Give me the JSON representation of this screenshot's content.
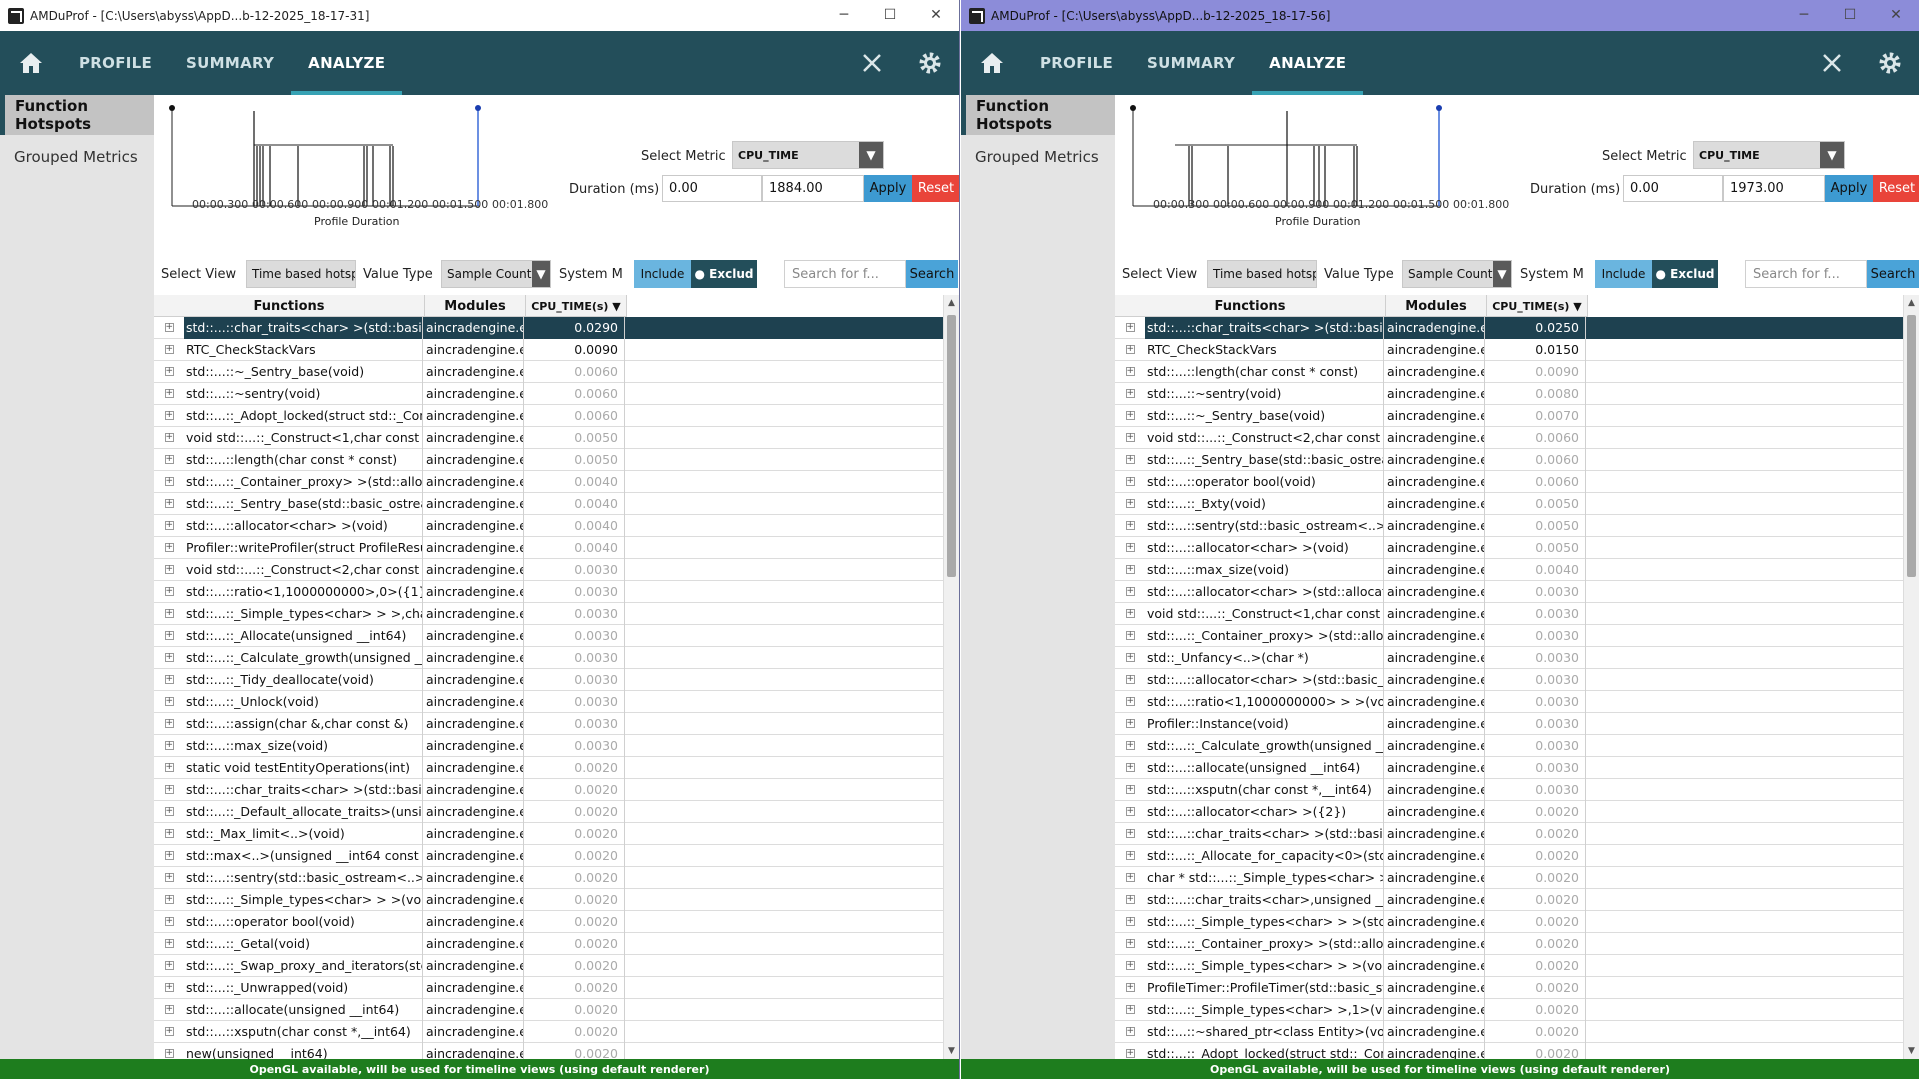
{
  "windows": [
    {
      "title": "AMDuProf - [C:\\Users\\abyss\\AppD...b-12-2025_18-17-31]",
      "window_buttons": [
        "─",
        "☐",
        "✕"
      ],
      "nav": {
        "tabs": [
          "PROFILE",
          "SUMMARY",
          "ANALYZE"
        ],
        "active": "ANALYZE"
      },
      "sidebar": [
        "Function Hotspots",
        "Grouped Metrics"
      ],
      "timeline": {
        "ticks": [
          "00:00.300",
          "00:00.600",
          "00:00.900",
          "00:01.200",
          "00:01.500",
          "00:01.800"
        ],
        "caption": "Profile Duration"
      },
      "controls": {
        "select_metric_label": "Select Metric",
        "metric_value": "CPU_TIME",
        "duration_label": "Duration (ms)",
        "duration_start": "0.00",
        "duration_end": "1884.00",
        "apply": "Apply",
        "reset": "Reset",
        "select_view_label": "Select View",
        "select_view_value": "Time based hotspots",
        "value_type_label": "Value Type",
        "value_type_value": "Sample Count",
        "system_label": "System M",
        "include": "Include",
        "exclude": "● Exclud",
        "search_placeholder": "Search for f...",
        "search_button": "Search"
      },
      "table": {
        "headers": [
          "Functions",
          "Modules",
          "CPU_TIME(s) ▼"
        ],
        "rows": [
          {
            "fn": "std::...::char_traits<char> >(std::basic_ostream",
            "mod": "aincradengine.exe",
            "cpu": "0.0290"
          },
          {
            "fn": "RTC_CheckStackVars",
            "mod": "aincradengine.exe",
            "cpu": "0.0090"
          },
          {
            "fn": "std::...::~_Sentry_base(void)",
            "mod": "aincradengine.exe",
            "cpu": "0.0060"
          },
          {
            "fn": "std::...::~sentry(void)",
            "mod": "aincradengine.exe",
            "cpu": "0.0060"
          },
          {
            "fn": "std::...::_Adopt_locked(struct std::_Container",
            "mod": "aincradengine.exe",
            "cpu": "0.0060"
          },
          {
            "fn": "void std::...::_Construct<1,char const *>",
            "mod": "aincradengine.exe",
            "cpu": "0.0050"
          },
          {
            "fn": "std::...::length(char const * const)",
            "mod": "aincradengine.exe",
            "cpu": "0.0050"
          },
          {
            "fn": "std::...::_Container_proxy> >(std::allocator",
            "mod": "aincradengine.exe",
            "cpu": "0.0040"
          },
          {
            "fn": "std::...::_Sentry_base(std::basic_ostream",
            "mod": "aincradengine.exe",
            "cpu": "0.0040"
          },
          {
            "fn": "std::...::allocator<char> >(void)",
            "mod": "aincradengine.exe",
            "cpu": "0.0040"
          },
          {
            "fn": "Profiler::writeProfiler(struct ProfileResult",
            "mod": "aincradengine.exe",
            "cpu": "0.0040"
          },
          {
            "fn": "void std::...::_Construct<2,char const *>",
            "mod": "aincradengine.exe",
            "cpu": "0.0030"
          },
          {
            "fn": "std::...::ratio<1,1000000000>,0>({1})",
            "mod": "aincradengine.exe",
            "cpu": "0.0030"
          },
          {
            "fn": "std::...::_Simple_types<char> > >,char>",
            "mod": "aincradengine.exe",
            "cpu": "0.0030"
          },
          {
            "fn": "std::...::_Allocate(unsigned __int64)",
            "mod": "aincradengine.exe",
            "cpu": "0.0030"
          },
          {
            "fn": "std::...::_Calculate_growth(unsigned __int64",
            "mod": "aincradengine.exe",
            "cpu": "0.0030"
          },
          {
            "fn": "std::...::_Tidy_deallocate(void)",
            "mod": "aincradengine.exe",
            "cpu": "0.0030"
          },
          {
            "fn": "std::...::_Unlock(void)",
            "mod": "aincradengine.exe",
            "cpu": "0.0030"
          },
          {
            "fn": "std::...::assign(char &,char const &)",
            "mod": "aincradengine.exe",
            "cpu": "0.0030"
          },
          {
            "fn": "std::...::max_size(void)",
            "mod": "aincradengine.exe",
            "cpu": "0.0030"
          },
          {
            "fn": "static void testEntityOperations(int)",
            "mod": "aincradengine.exe",
            "cpu": "0.0020"
          },
          {
            "fn": "std::...::char_traits<char> >(std::basic_ostream",
            "mod": "aincradengine.exe",
            "cpu": "0.0020"
          },
          {
            "fn": "std::...::_Default_allocate_traits>(unsigned",
            "mod": "aincradengine.exe",
            "cpu": "0.0020"
          },
          {
            "fn": "std::_Max_limit<..>(void)",
            "mod": "aincradengine.exe",
            "cpu": "0.0020"
          },
          {
            "fn": "std::max<..>(unsigned __int64 const &,unsigned",
            "mod": "aincradengine.exe",
            "cpu": "0.0020"
          },
          {
            "fn": "std::...::sentry(std::basic_ostream<..> &",
            "mod": "aincradengine.exe",
            "cpu": "0.0020"
          },
          {
            "fn": "std::...::_Simple_types<char> > >(void)",
            "mod": "aincradengine.exe",
            "cpu": "0.0020"
          },
          {
            "fn": "std::...::operator bool(void)",
            "mod": "aincradengine.exe",
            "cpu": "0.0020"
          },
          {
            "fn": "std::...::_Getal(void)",
            "mod": "aincradengine.exe",
            "cpu": "0.0020"
          },
          {
            "fn": "std::...::_Swap_proxy_and_iterators(std::",
            "mod": "aincradengine.exe",
            "cpu": "0.0020"
          },
          {
            "fn": "std::...::_Unwrapped(void)",
            "mod": "aincradengine.exe",
            "cpu": "0.0020"
          },
          {
            "fn": "std::...::allocate(unsigned __int64)",
            "mod": "aincradengine.exe",
            "cpu": "0.0020"
          },
          {
            "fn": "std::...::xsputn(char const *,__int64)",
            "mod": "aincradengine.exe",
            "cpu": "0.0020"
          },
          {
            "fn": "new(unsigned __int64)",
            "mod": "aincradengine.exe",
            "cpu": "0.0020"
          }
        ]
      },
      "status": "OpenGL available, will be used for timeline views (using default renderer)"
    },
    {
      "title": "AMDuProf - [C:\\Users\\abyss\\AppD...b-12-2025_18-17-56]",
      "window_buttons": [
        "─",
        "☐",
        "✕"
      ],
      "nav": {
        "tabs": [
          "PROFILE",
          "SUMMARY",
          "ANALYZE"
        ],
        "active": "ANALYZE"
      },
      "sidebar": [
        "Function Hotspots",
        "Grouped Metrics"
      ],
      "timeline": {
        "ticks": [
          "00:00.300",
          "00:00.600",
          "00:00.900",
          "00:01.200",
          "00:01.500",
          "00:01.800"
        ],
        "caption": "Profile Duration"
      },
      "controls": {
        "select_metric_label": "Select Metric",
        "metric_value": "CPU_TIME",
        "duration_label": "Duration (ms)",
        "duration_start": "0.00",
        "duration_end": "1973.00",
        "apply": "Apply",
        "reset": "Reset",
        "select_view_label": "Select View",
        "select_view_value": "Time based hotspots",
        "value_type_label": "Value Type",
        "value_type_value": "Sample Count",
        "system_label": "System M",
        "include": "Include",
        "exclude": "● Exclud",
        "search_placeholder": "Search for f...",
        "search_button": "Search"
      },
      "table": {
        "headers": [
          "Functions",
          "Modules",
          "CPU_TIME(s) ▼"
        ],
        "rows": [
          {
            "fn": "std::...::char_traits<char> >(std::basic_ostream",
            "mod": "aincradengine.exe",
            "cpu": "0.0250"
          },
          {
            "fn": "RTC_CheckStackVars",
            "mod": "aincradengine.exe",
            "cpu": "0.0150"
          },
          {
            "fn": "std::...::length(char const * const)",
            "mod": "aincradengine.exe",
            "cpu": "0.0090"
          },
          {
            "fn": "std::...::~sentry(void)",
            "mod": "aincradengine.exe",
            "cpu": "0.0080"
          },
          {
            "fn": "std::...::~_Sentry_base(void)",
            "mod": "aincradengine.exe",
            "cpu": "0.0070"
          },
          {
            "fn": "void std::...::_Construct<2,char const *>",
            "mod": "aincradengine.exe",
            "cpu": "0.0060"
          },
          {
            "fn": "std::...::_Sentry_base(std::basic_ostream",
            "mod": "aincradengine.exe",
            "cpu": "0.0060"
          },
          {
            "fn": "std::...::operator bool(void)",
            "mod": "aincradengine.exe",
            "cpu": "0.0060"
          },
          {
            "fn": "std::...::_Bxty(void)",
            "mod": "aincradengine.exe",
            "cpu": "0.0050"
          },
          {
            "fn": "std::...::sentry(std::basic_ostream<..> &",
            "mod": "aincradengine.exe",
            "cpu": "0.0050"
          },
          {
            "fn": "std::...::allocator<char> >(void)",
            "mod": "aincradengine.exe",
            "cpu": "0.0050"
          },
          {
            "fn": "std::...::max_size(void)",
            "mod": "aincradengine.exe",
            "cpu": "0.0040"
          },
          {
            "fn": "std::...::allocator<char> >(std::allocator<char>",
            "mod": "aincradengine.exe",
            "cpu": "0.0030"
          },
          {
            "fn": "void std::...::_Construct<1,char const *>",
            "mod": "aincradengine.exe",
            "cpu": "0.0030"
          },
          {
            "fn": "std::...::_Container_proxy> >(std::allocator",
            "mod": "aincradengine.exe",
            "cpu": "0.0030"
          },
          {
            "fn": "std::_Unfancy<..>(char *)",
            "mod": "aincradengine.exe",
            "cpu": "0.0030"
          },
          {
            "fn": "std::...::allocator<char> >(std::basic_string",
            "mod": "aincradengine.exe",
            "cpu": "0.0030"
          },
          {
            "fn": "std::...::ratio<1,1000000000> > >(void)",
            "mod": "aincradengine.exe",
            "cpu": "0.0030"
          },
          {
            "fn": "Profiler::Instance(void)",
            "mod": "aincradengine.exe",
            "cpu": "0.0030"
          },
          {
            "fn": "std::...::_Calculate_growth(unsigned __int64",
            "mod": "aincradengine.exe",
            "cpu": "0.0030"
          },
          {
            "fn": "std::...::allocate(unsigned __int64)",
            "mod": "aincradengine.exe",
            "cpu": "0.0030"
          },
          {
            "fn": "std::...::xsputn(char const *,__int64)",
            "mod": "aincradengine.exe",
            "cpu": "0.0030"
          },
          {
            "fn": "std::...::allocator<char> >({2})",
            "mod": "aincradengine.exe",
            "cpu": "0.0020"
          },
          {
            "fn": "std::...::char_traits<char> >(std::basic_ostream",
            "mod": "aincradengine.exe",
            "cpu": "0.0020"
          },
          {
            "fn": "std::...::_Allocate_for_capacity<0>(std::allocator",
            "mod": "aincradengine.exe",
            "cpu": "0.0020"
          },
          {
            "fn": "char * std::...::_Simple_types<char> > >",
            "mod": "aincradengine.exe",
            "cpu": "0.0020"
          },
          {
            "fn": "std::...::char_traits<char>,unsigned __int64",
            "mod": "aincradengine.exe",
            "cpu": "0.0020"
          },
          {
            "fn": "std::...::_Simple_types<char> > >(std::_",
            "mod": "aincradengine.exe",
            "cpu": "0.0020"
          },
          {
            "fn": "std::...::_Container_proxy> >(std::allocator",
            "mod": "aincradengine.exe",
            "cpu": "0.0020"
          },
          {
            "fn": "std::...::_Simple_types<char> > >(void)",
            "mod": "aincradengine.exe",
            "cpu": "0.0020"
          },
          {
            "fn": "ProfileTimer::ProfileTimer(std::basic_string",
            "mod": "aincradengine.exe",
            "cpu": "0.0020"
          },
          {
            "fn": "std::...::_Simple_types<char> >,1>(void)",
            "mod": "aincradengine.exe",
            "cpu": "0.0020"
          },
          {
            "fn": "std::...::~shared_ptr<class Entity>(void)",
            "mod": "aincradengine.exe",
            "cpu": "0.0020"
          },
          {
            "fn": "std::...::_Adopt_locked(struct std::_Container",
            "mod": "aincradengine.exe",
            "cpu": "0.0020"
          }
        ]
      },
      "status": "OpenGL available, will be used for timeline views (using default renderer)"
    }
  ],
  "icons": {
    "home": "home-icon",
    "close": "close-icon",
    "settings": "gear-icon",
    "expand": "expand-icon",
    "dropdown": "chevron-down-icon"
  },
  "colors": {
    "nav_bg": "#234e5a",
    "accent": "#37a2b4",
    "selected_row": "#1e4150",
    "apply": "#3d9ad1",
    "reset": "#e9443a",
    "status_bar": "#1e7d1e"
  }
}
